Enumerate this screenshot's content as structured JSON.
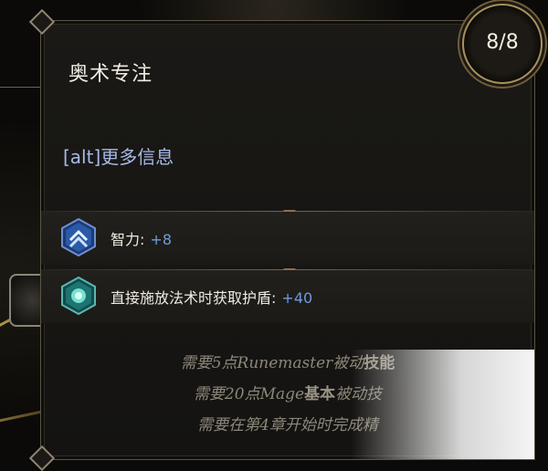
{
  "tooltip": {
    "title": "奥术专注",
    "alt_info": "[alt]更多信息",
    "stats": [
      {
        "label": "智力:",
        "value": "+8",
        "icon": "intelligence-chevron-icon"
      },
      {
        "label": "直接施放法术时获取护盾:",
        "value": "+40",
        "icon": "shield-gem-icon"
      }
    ],
    "requirements": [
      {
        "pre": "需要5点Runemaster被动",
        "bold": "技能"
      },
      {
        "pre": "需要20点Mage",
        "bold": "基本",
        "post": "被动技"
      },
      {
        "pre": "需要在第4章开始时完成精",
        "bold": "",
        "post": ""
      }
    ]
  },
  "counter": {
    "text": "8/8"
  },
  "colors": {
    "stat_value": "#6d9be0",
    "alt_info": "#a7b9e8",
    "badge_ring": "#a8915e"
  }
}
